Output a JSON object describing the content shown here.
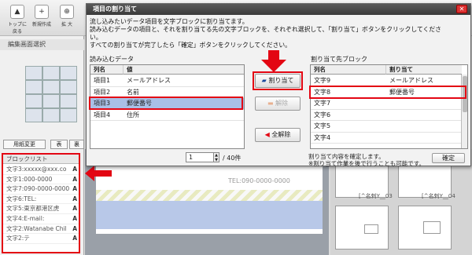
{
  "toolbar": {
    "buttons": [
      {
        "label": "トップに戻る",
        "icon": "up-arrow-icon"
      },
      {
        "label": "新規作成",
        "icon": "new-doc-icon"
      },
      {
        "label": "拡 大",
        "icon": "zoom-in-icon"
      }
    ]
  },
  "left_panel": {
    "title": "編集画面選択",
    "buttons": [
      "用紙変更",
      "表",
      "裏"
    ]
  },
  "block_list": {
    "header": "ブロックリスト",
    "rows": [
      {
        "text": "文字3:xxxxx@xxx.co",
        "mark": "A"
      },
      {
        "text": "文字1:000-0000",
        "mark": "A"
      },
      {
        "text": "文字7:090-0000-0000",
        "mark": "A"
      },
      {
        "text": "文字6:TEL:",
        "mark": "A"
      },
      {
        "text": "文字5:東京都港区虎",
        "mark": "A"
      },
      {
        "text": "文字4:E-mail:",
        "mark": "A"
      },
      {
        "text": "文字2:Watanabe Chil",
        "mark": "A"
      },
      {
        "text": "文字2:テ",
        "mark": "A"
      }
    ]
  },
  "canvas": {
    "tel_text": "TEL:090-0000-0000",
    "cards": [
      "[^名刺Y__03",
      "[^名刺Y__04"
    ]
  },
  "dialog": {
    "title": "項目の割り当て",
    "close": "✕",
    "instructions": [
      "流し込みたいデータ項目を文字ブロックに割り当てます。",
      "読み込むデータの項目と、それを割り当てる先の文字ブロックを、それぞれ選択して、「割り当て」ボタンをクリックしてくださ",
      "い。",
      "すべての割り当てが完了したら「確定」ボタンをクリックしてください。"
    ],
    "source": {
      "label": "読み込むデータ",
      "columns": [
        "列名",
        "値"
      ],
      "rows": [
        {
          "name": "項目1",
          "value": "メールアドレス"
        },
        {
          "name": "項目2",
          "value": "名前"
        },
        {
          "name": "項目3",
          "value": "郵便番号"
        },
        {
          "name": "項目4",
          "value": "住所"
        }
      ]
    },
    "buttons": {
      "assign": "割り当て",
      "unassign": "解除",
      "unassign_all": "全解除"
    },
    "pager": {
      "value": "1",
      "total": "/ 40件"
    },
    "target": {
      "label": "割り当て先ブロック",
      "columns": [
        "列名",
        "割り当て"
      ],
      "rows": [
        {
          "name": "文字9",
          "value": "メールアドレス"
        },
        {
          "name": "文字8",
          "value": "郵便番号"
        },
        {
          "name": "文字7",
          "value": ""
        },
        {
          "name": "文字6",
          "value": ""
        },
        {
          "name": "文字5",
          "value": ""
        },
        {
          "name": "文字4",
          "value": ""
        }
      ]
    },
    "confirm_note": [
      "割り当て内容を確定します。",
      "※割り当て作業を後で行うことも可能です。"
    ],
    "confirm_button": "確定"
  },
  "colors": {
    "highlight": "#e30613",
    "selection": "#a9c0e6",
    "title_bar": "#444444"
  }
}
